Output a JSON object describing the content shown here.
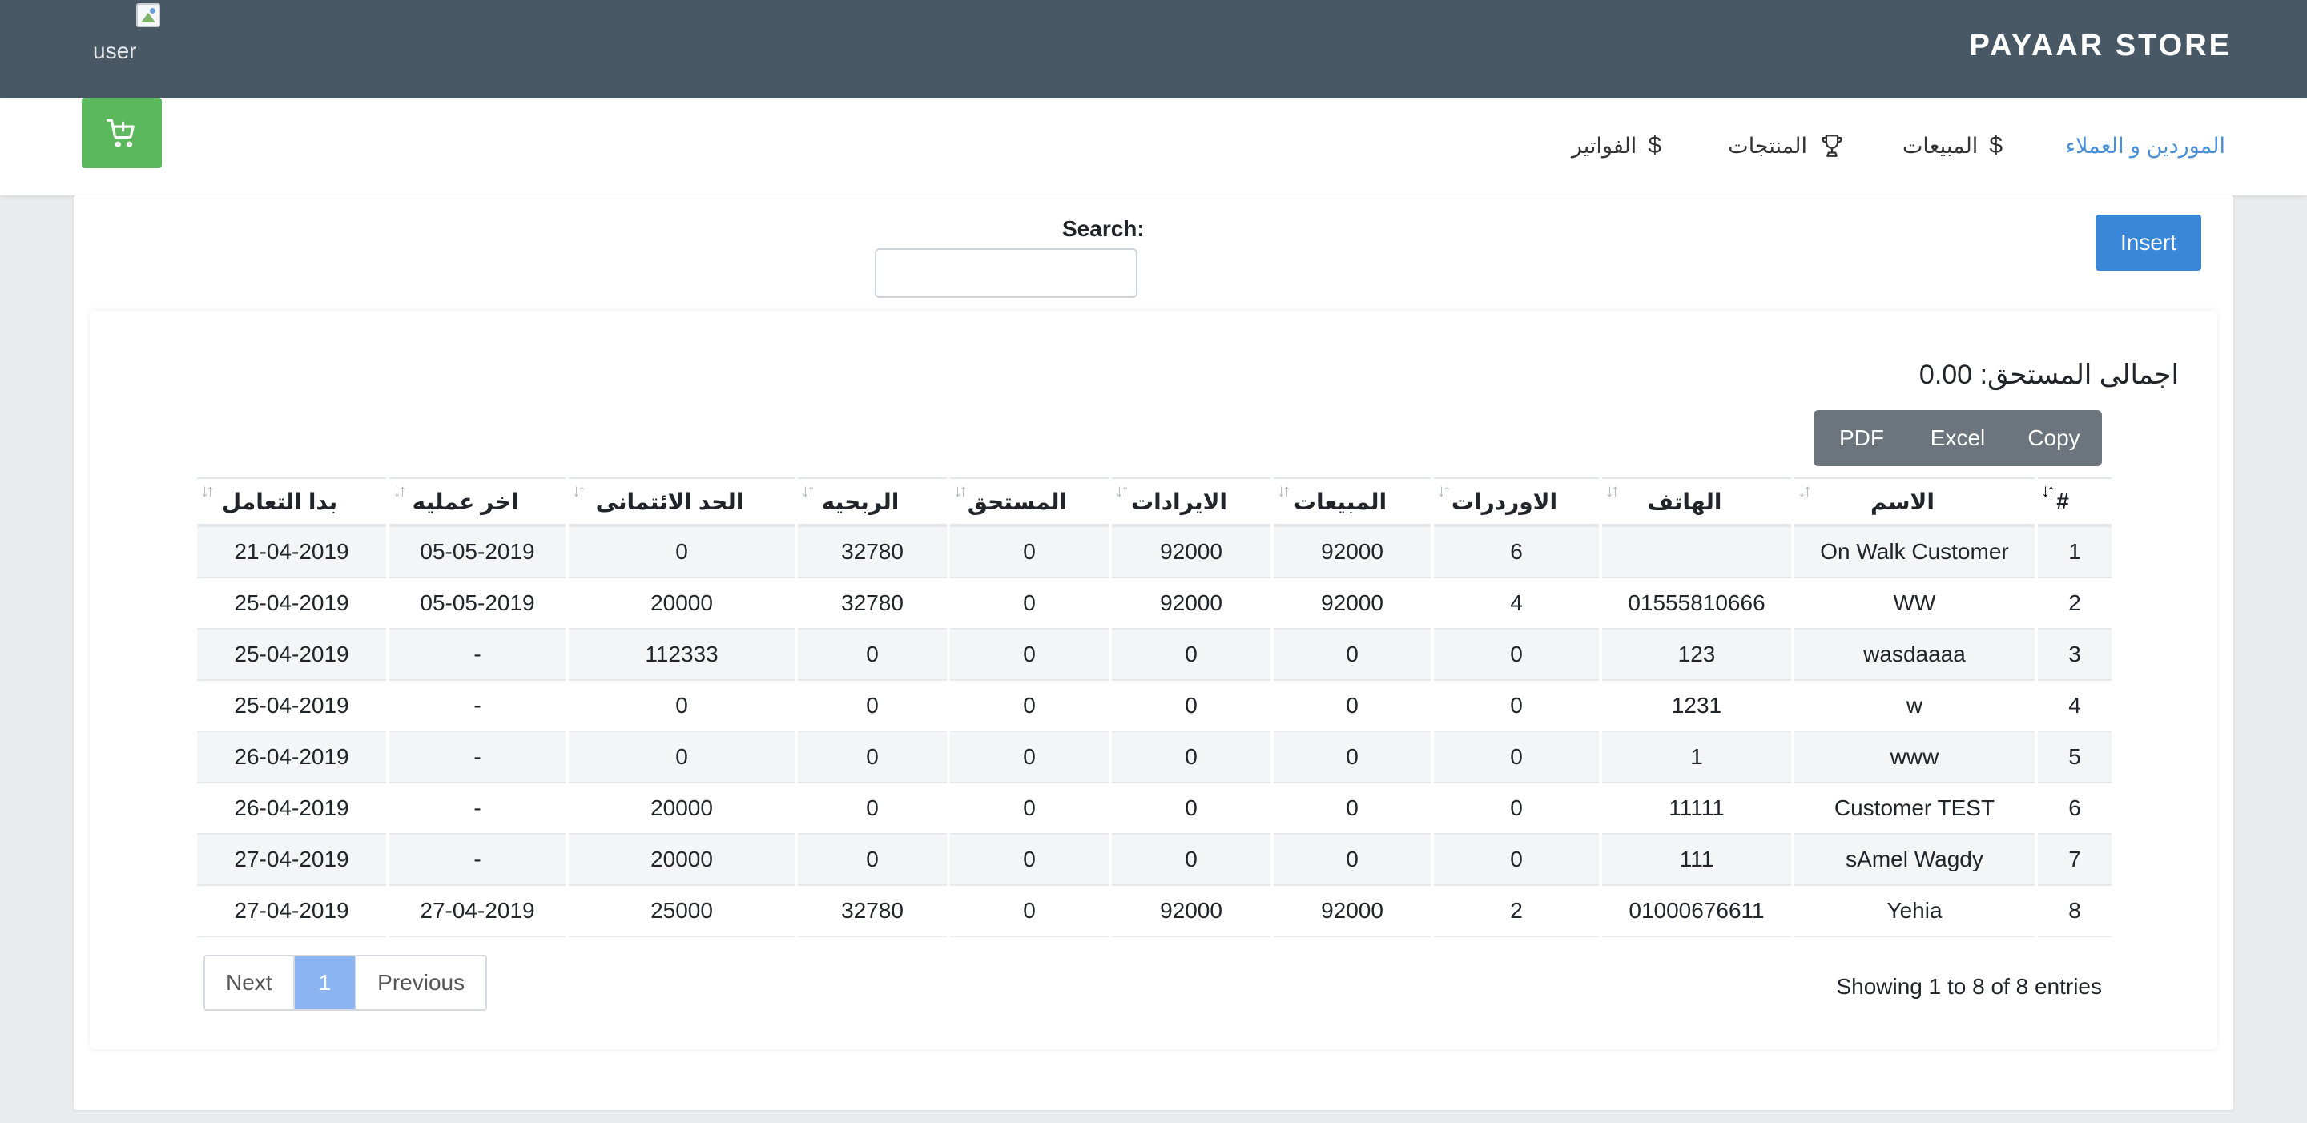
{
  "header": {
    "brand": "PAYAAR STORE",
    "user_alt": "user"
  },
  "nav": {
    "items": [
      {
        "label": "الموردين و العملاء",
        "active": true
      },
      {
        "label": "المبيعات",
        "icon": "$"
      },
      {
        "label": "المنتجات",
        "icon": "trophy-icon"
      },
      {
        "label": "الفواتير",
        "icon": "$"
      }
    ],
    "cart_icon": "cart-plus-icon"
  },
  "toolbar": {
    "insert_label": "Insert",
    "search_label": "Search:",
    "search_value": ""
  },
  "summary": {
    "total_label": "اجمالى المستحق:",
    "total_value": "0.00"
  },
  "export": {
    "copy": "Copy",
    "excel": "Excel",
    "pdf": "PDF"
  },
  "table": {
    "columns": [
      "#",
      "الاسم",
      "الهاتف",
      "الاوردرات",
      "المبيعات",
      "الايرادات",
      "المستحق",
      "الربحيه",
      "الحد الائتمانى",
      "اخر عمليه",
      "بدا التعامل"
    ],
    "rows": [
      [
        "1",
        "On Walk Customer",
        "",
        "6",
        "92000",
        "92000",
        "0",
        "32780",
        "0",
        "05-05-2019",
        "21-04-2019"
      ],
      [
        "2",
        "WW",
        "01555810666",
        "4",
        "92000",
        "92000",
        "0",
        "32780",
        "20000",
        "05-05-2019",
        "25-04-2019"
      ],
      [
        "3",
        "wasdaaaa",
        "123",
        "0",
        "0",
        "0",
        "0",
        "0",
        "112333",
        "-",
        "25-04-2019"
      ],
      [
        "4",
        "w",
        "1231",
        "0",
        "0",
        "0",
        "0",
        "0",
        "0",
        "-",
        "25-04-2019"
      ],
      [
        "5",
        "www",
        "1",
        "0",
        "0",
        "0",
        "0",
        "0",
        "0",
        "-",
        "26-04-2019"
      ],
      [
        "6",
        "Customer TEST",
        "11111",
        "0",
        "0",
        "0",
        "0",
        "0",
        "20000",
        "-",
        "26-04-2019"
      ],
      [
        "7",
        "sAmel Wagdy",
        "111",
        "0",
        "0",
        "0",
        "0",
        "0",
        "20000",
        "-",
        "27-04-2019"
      ],
      [
        "8",
        "Yehia",
        "01000676611",
        "2",
        "92000",
        "92000",
        "0",
        "32780",
        "25000",
        "27-04-2019",
        "27-04-2019"
      ]
    ]
  },
  "footer": {
    "info": "Showing 1 to 8 of 8 entries",
    "previous": "Previous",
    "page": "1",
    "next": "Next"
  }
}
